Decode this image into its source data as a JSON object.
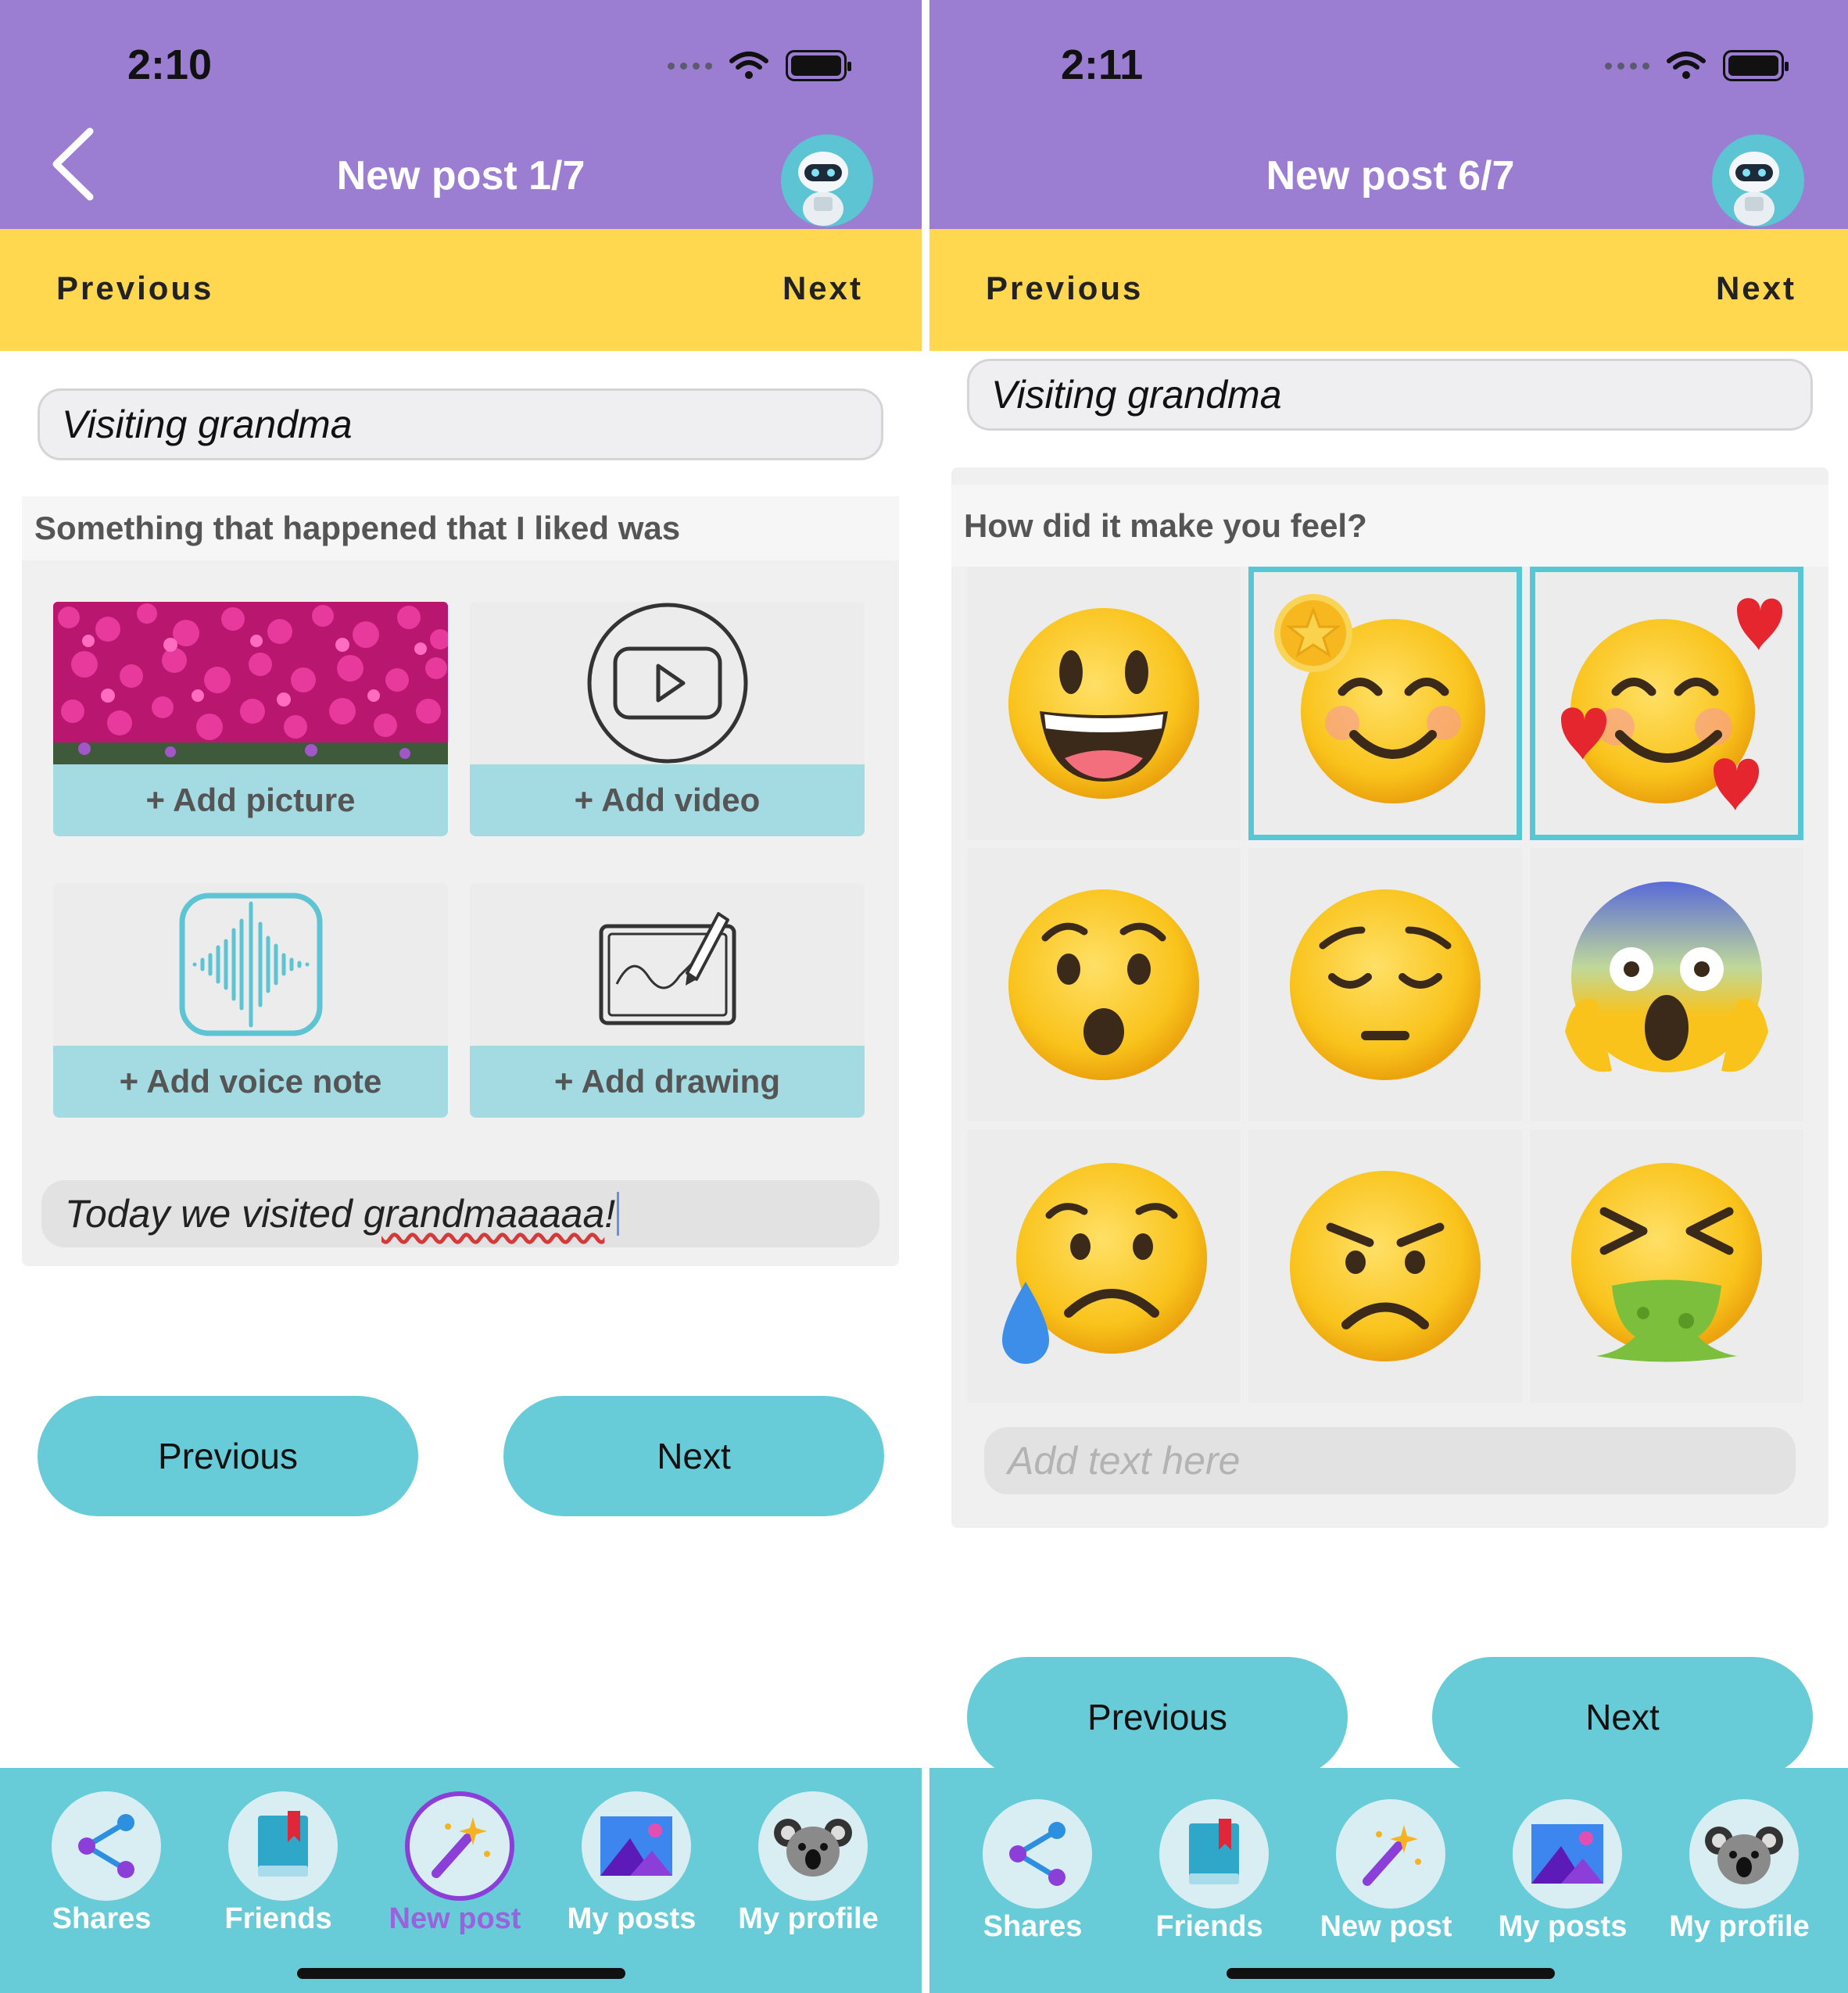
{
  "left": {
    "status": {
      "time": "2:10"
    },
    "header": {
      "title": "New post 1/7"
    },
    "stepbar": {
      "previous": "Previous",
      "next": "Next"
    },
    "post_title": "Visiting grandma",
    "prompt": "Something that happened that I liked was",
    "media": {
      "picture": "+ Add picture",
      "video": "+ Add video",
      "voice": "+ Add voice note",
      "drawing": "+ Add drawing"
    },
    "entry": {
      "text_before": "Today we visited ",
      "text_misspelled": "grandmaaaaa",
      "text_after": "!"
    },
    "buttons": {
      "previous": "Previous",
      "next": "Next"
    },
    "active_tab": "New post"
  },
  "right": {
    "status": {
      "time": "2:11"
    },
    "header": {
      "title": "New post 6/7"
    },
    "stepbar": {
      "previous": "Previous",
      "next": "Next"
    },
    "post_title": "Visiting grandma",
    "prompt": "How did it make you feel?",
    "emotions": [
      {
        "icon": "grinning-face-icon",
        "selected": false
      },
      {
        "icon": "smiling-face-icon",
        "selected": true,
        "favorite": true
      },
      {
        "icon": "smiling-face-with-hearts-icon",
        "selected": true
      },
      {
        "icon": "surprised-face-icon",
        "selected": false
      },
      {
        "icon": "pensive-face-icon",
        "selected": false
      },
      {
        "icon": "screaming-face-icon",
        "selected": false
      },
      {
        "icon": "sad-sweat-face-icon",
        "selected": false
      },
      {
        "icon": "angry-face-icon",
        "selected": false
      },
      {
        "icon": "vomiting-face-icon",
        "selected": false
      }
    ],
    "text_placeholder": "Add text here",
    "buttons": {
      "previous": "Previous",
      "next": "Next"
    }
  },
  "tabs": [
    {
      "label": "Shares",
      "icon": "share-icon"
    },
    {
      "label": "Friends",
      "icon": "book-icon"
    },
    {
      "label": "New post",
      "icon": "magic-wand-icon"
    },
    {
      "label": "My posts",
      "icon": "picture-icon"
    },
    {
      "label": "My profile",
      "icon": "koala-icon"
    }
  ],
  "colors": {
    "header": "#9b7dd1",
    "stepbar": "#ffd84f",
    "accent": "#67ccd8",
    "tile_footer": "#a4dbe2",
    "active_tab": "#9b62dd"
  }
}
